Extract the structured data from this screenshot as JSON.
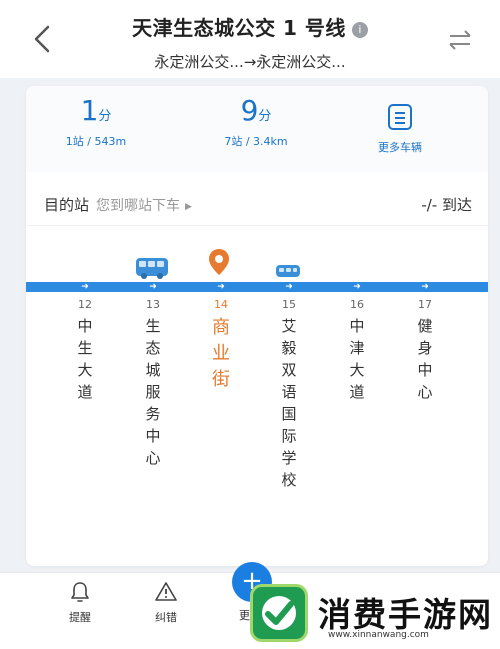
{
  "header": {
    "title": "天津生态城公交 1 号线",
    "info_icon": "info-icon",
    "subtitle": "永定洲公交...→永定洲公交...",
    "back_icon": "back-chevron-icon",
    "swap_icon": "swap-direction-icon"
  },
  "stats": [
    {
      "value": "1",
      "unit": "分",
      "sub": "1站 / 543m"
    },
    {
      "value": "9",
      "unit": "分",
      "sub": "7站 / 3.4km"
    },
    {
      "label": "更多车辆",
      "icon": "list-icon"
    }
  ],
  "destination": {
    "label": "目的站",
    "prompt": "您到哪站下车",
    "arrival": "-/- 到达"
  },
  "stops": [
    {
      "index": "12",
      "name": "中\n生\n大\n道"
    },
    {
      "index": "13",
      "name": "生\n态\n城\n服\n务\n中\n心"
    },
    {
      "index": "14",
      "name": "商\n业\n街",
      "current": true
    },
    {
      "index": "15",
      "name": "艾\n毅\n双\n语\n国\n际\n学\n校"
    },
    {
      "index": "16",
      "name": "中\n津\n大\n道"
    },
    {
      "index": "17",
      "name": "健\n身\n中\n心"
    }
  ],
  "bottom": {
    "remind_label": "提醒",
    "error_label": "纠错",
    "more_label": "更"
  },
  "watermark": {
    "title": "消费手游网",
    "url": "www.xinnanwang.com"
  },
  "colors": {
    "accent": "#1a73c8",
    "route": "#2c8be0",
    "current_stop": "#e67a2e"
  }
}
